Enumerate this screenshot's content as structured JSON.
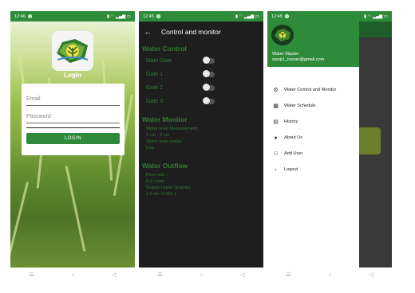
{
  "login_screen": {
    "status_time": "12:46",
    "title": "Login",
    "email_placeholder": "Email",
    "password_placeholder": "Password",
    "login_button": "LOGIN"
  },
  "control_screen": {
    "status_time": "12:45",
    "toolbar_title": "Control and monitor",
    "water_control": {
      "heading": "Water Control",
      "gates": [
        {
          "label": "Main Gate",
          "on": false
        },
        {
          "label": "Gate 1",
          "on": false
        },
        {
          "label": "Gate 2",
          "on": false
        },
        {
          "label": "Gate 3",
          "on": false
        }
      ]
    },
    "water_monitor": {
      "heading": "Water Monitor",
      "level_measurement_label": "Water level Measurement:",
      "level_measurement_value": "1 cm - 3 cm",
      "level_status_label": "Water level status:",
      "level_status_value": "Low"
    },
    "water_outflow": {
      "heading": "Water Outflow",
      "flow_rate_label": "Flow rate :",
      "flow_rate_value": "0.0 L/min",
      "output_quantity_label": "Output Liquid Quantity :",
      "output_quantity_value": "1.0 ml  / 0.001 L"
    }
  },
  "drawer_screen": {
    "status_time": "12:45",
    "user_name": "Water Master",
    "user_email": "swsp1_bsoan@gmail.com",
    "menu": [
      {
        "label": "Water Control and Monitor",
        "icon": "gear-icon"
      },
      {
        "label": "Water Schedule",
        "icon": "calendar-icon"
      },
      {
        "label": "History",
        "icon": "library-icon"
      },
      {
        "label": "About Us",
        "icon": "info-icon"
      },
      {
        "label": "Add User",
        "icon": "add-person-icon"
      },
      {
        "label": "Logout",
        "icon": "chevron-right-icon"
      }
    ]
  },
  "colors": {
    "brand_green": "#2e8b3a",
    "dark_bg": "#1e1e1e",
    "section_green": "#2e7d32"
  },
  "nav": {
    "recents": "☰",
    "home": "○",
    "back": "◁"
  }
}
